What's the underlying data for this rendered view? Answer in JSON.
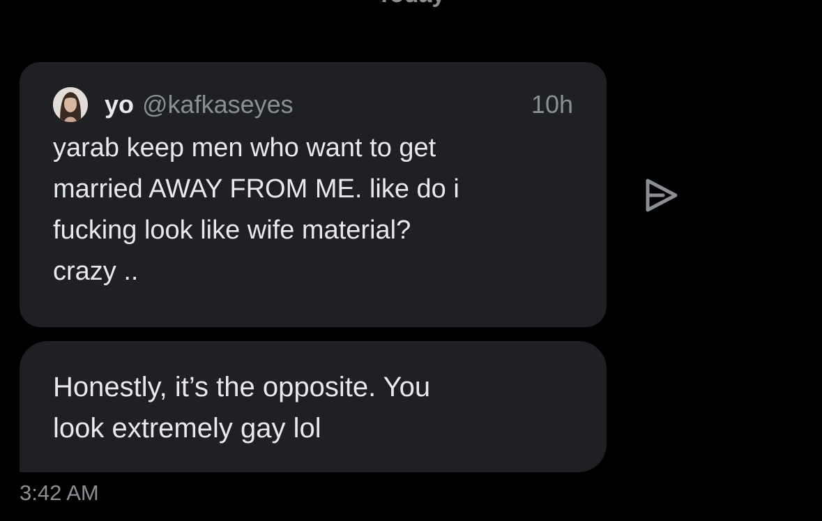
{
  "header": {
    "date_label": "Today"
  },
  "quoted_tweet": {
    "author_name": "yo",
    "author_handle": "@kafkaseyes",
    "time_ago": "10h",
    "text": "yarab keep men who want to get\nmarried AWAY FROM ME. like do i\nfucking look like wife material?\ncrazy .."
  },
  "reply": {
    "text": "Honestly, it’s the opposite. You\nlook extremely gay lol",
    "timestamp": "3:42 AM"
  },
  "icons": {
    "share": "share-arrow-icon",
    "avatar": "avatar"
  },
  "colors": {
    "background": "#000000",
    "bubble": "#1f2023",
    "text_primary": "#e7e9ea",
    "text_secondary": "#8b8f94"
  }
}
